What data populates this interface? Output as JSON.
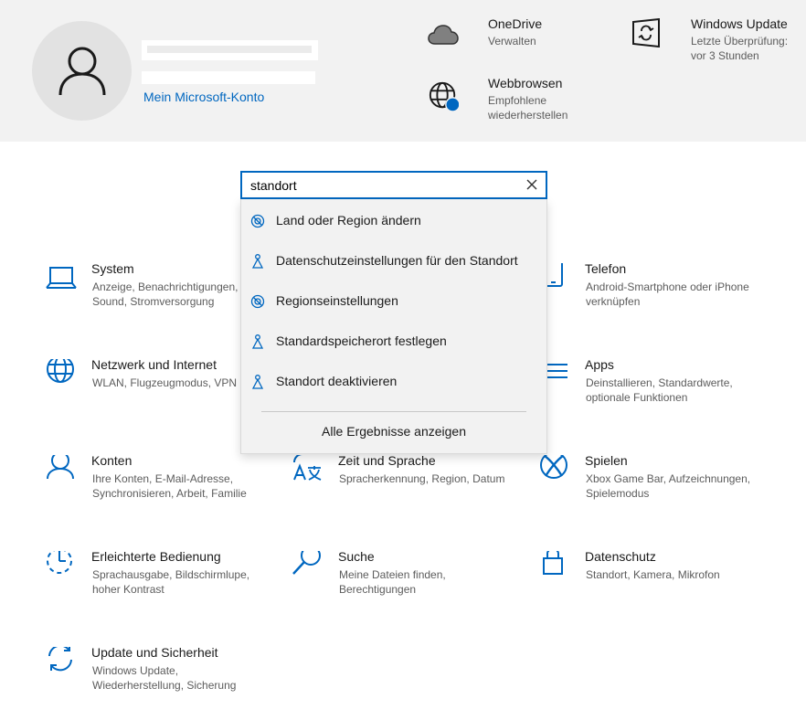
{
  "header": {
    "account_link": "Mein Microsoft-Konto",
    "quick_items": [
      {
        "title": "OneDrive",
        "subtitle": "Verwalten",
        "icon": "cloud-icon"
      },
      {
        "title": "Windows Update",
        "subtitle": "Letzte Überprüfung: vor 3 Stunden",
        "icon": "windows-update-icon"
      },
      {
        "title": "Webbrowsen",
        "subtitle": "Empfohlene wiederherstellen",
        "icon": "globe-badge-icon"
      }
    ]
  },
  "search": {
    "value": "standort",
    "results": [
      {
        "label": "Land oder Region ändern",
        "icon": "globe-icon"
      },
      {
        "label": "Datenschutzeinstellungen für den Standort",
        "icon": "location-person-icon"
      },
      {
        "label": "Regionseinstellungen",
        "icon": "globe-icon"
      },
      {
        "label": "Standardspeicherort festlegen",
        "icon": "location-person-icon"
      },
      {
        "label": "Standort deaktivieren",
        "icon": "location-person-icon"
      }
    ],
    "all_results": "Alle Ergebnisse anzeigen"
  },
  "tiles": [
    {
      "title": "System",
      "subtitle": "Anzeige, Benachrichtigungen, Sound, Stromversorgung",
      "icon": "laptop-icon"
    },
    {
      "title": "Telefon",
      "subtitle": "Android-Smartphone oder iPhone verknüpfen",
      "icon": "phone-icon"
    },
    {
      "title": "Netzwerk und Internet",
      "subtitle": "WLAN, Flugzeugmodus, VPN",
      "icon": "globe-icon"
    },
    {
      "title": "Apps",
      "subtitle": "Deinstallieren, Standardwerte, optionale Funktionen",
      "icon": "apps-list-icon"
    },
    {
      "title": "Konten",
      "subtitle": "Ihre Konten, E-Mail-Adresse, Synchronisieren, Arbeit, Familie",
      "icon": "person-icon"
    },
    {
      "title": "Zeit und Sprache",
      "subtitle": "Spracherkennung, Region, Datum",
      "icon": "time-language-icon"
    },
    {
      "title": "Spielen",
      "subtitle": "Xbox Game Bar, Aufzeichnungen, Spielemodus",
      "icon": "xbox-icon"
    },
    {
      "title": "Erleichterte Bedienung",
      "subtitle": "Sprachausgabe, Bildschirmlupe, hoher Kontrast",
      "icon": "ease-of-access-icon"
    },
    {
      "title": "Suche",
      "subtitle": "Meine Dateien finden, Berechtigungen",
      "icon": "search-icon"
    },
    {
      "title": "Datenschutz",
      "subtitle": "Standort, Kamera, Mikrofon",
      "icon": "lock-icon"
    },
    {
      "title": "Update und Sicherheit",
      "subtitle": "Windows Update, Wiederherstellung, Sicherung",
      "icon": "sync-icon"
    }
  ],
  "colors": {
    "accent": "#0067c0",
    "header_bg": "#f2f2f2",
    "dropdown_bg": "#f2f2f2"
  }
}
